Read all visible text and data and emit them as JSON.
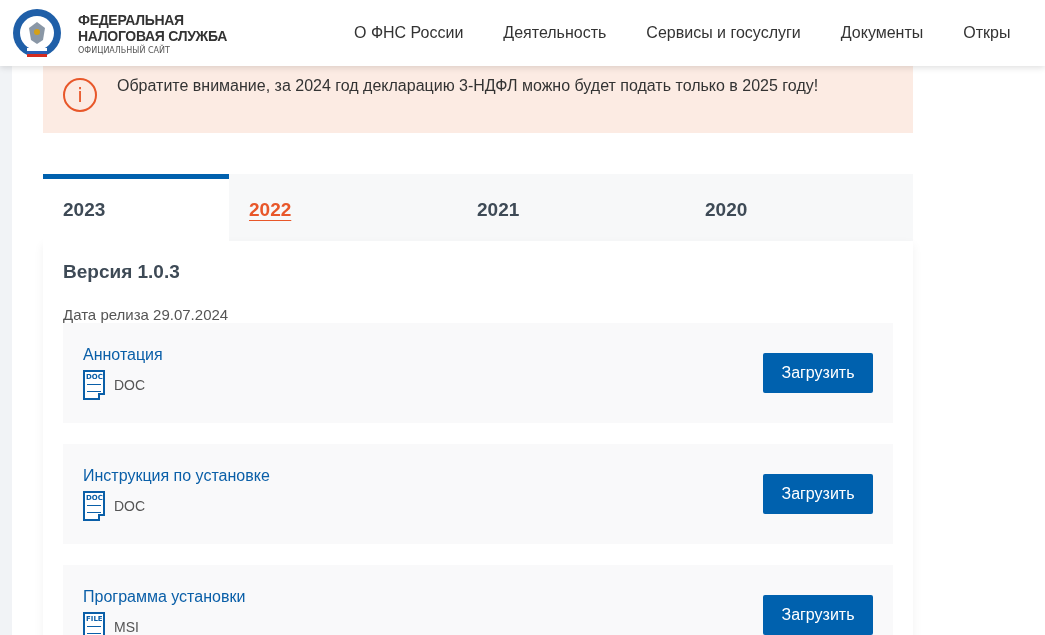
{
  "header": {
    "logo_title_line1": "ФЕДЕРАЛЬНАЯ",
    "logo_title_line2": "НАЛОГОВАЯ СЛУЖБА",
    "logo_subtitle": "ОФИЦИАЛЬНЫЙ САЙТ",
    "nav": [
      "О ФНС России",
      "Деятельность",
      "Сервисы и госуслуги",
      "Документы",
      "Откры"
    ]
  },
  "notice": {
    "icon": "i",
    "text": "Обратите внимание, за 2024 год декларацию 3-НДФЛ можно будет подать только в 2025 году!"
  },
  "tabs": [
    {
      "label": "2023",
      "selected": true,
      "hovered": false
    },
    {
      "label": "2022",
      "selected": false,
      "hovered": true
    },
    {
      "label": "2021",
      "selected": false,
      "hovered": false
    },
    {
      "label": "2020",
      "selected": false,
      "hovered": false
    }
  ],
  "version": {
    "title": "Версия 1.0.3",
    "release_date": "Дата релиза 29.07.2024"
  },
  "files": [
    {
      "name": "Аннотация",
      "icon_label": "DOC",
      "format": "DOC",
      "button": "Загрузить"
    },
    {
      "name": "Инструкция по установке",
      "icon_label": "DOC",
      "format": "DOC",
      "button": "Загрузить"
    },
    {
      "name": "Программа установки",
      "icon_label": "FILE",
      "format": "MSI",
      "button": "Загрузить"
    }
  ]
}
